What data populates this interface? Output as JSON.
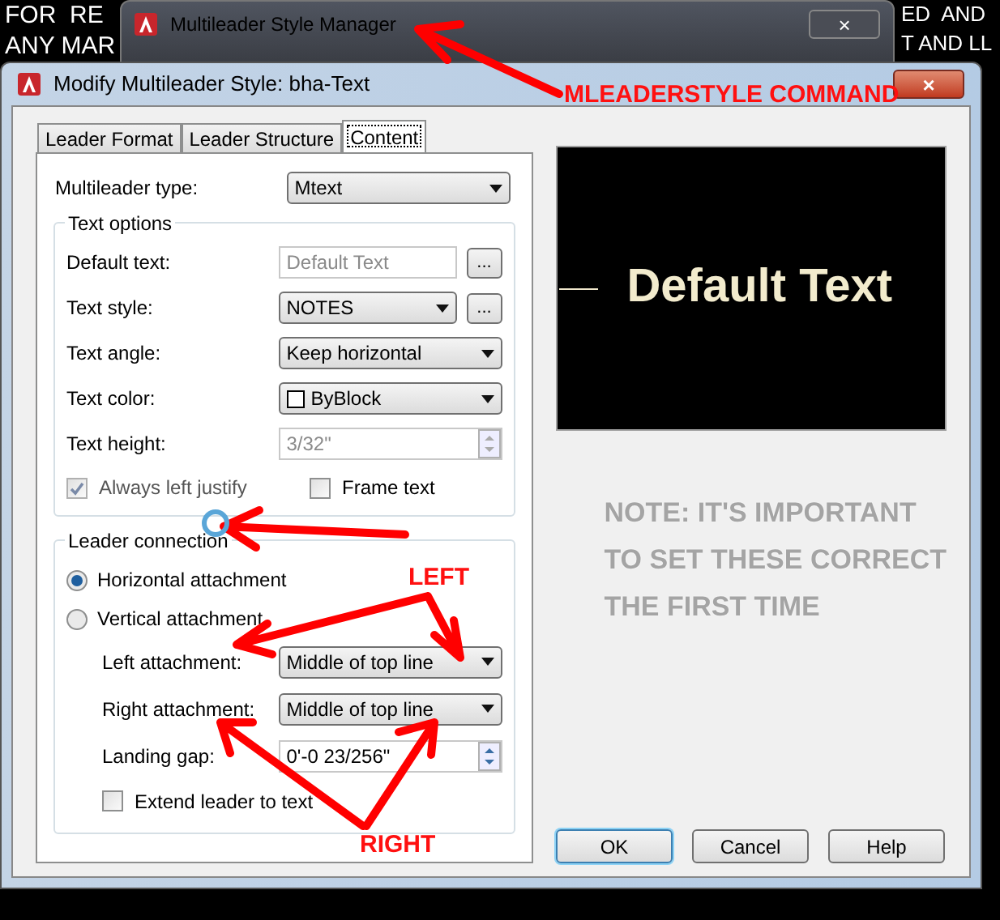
{
  "cad_background": {
    "left_lines": [
      "FOR  RE",
      "ANY MAR"
    ],
    "right_lines": [
      "ED  AND",
      "T AND LL"
    ]
  },
  "back_window": {
    "title": "Multileader Style Manager",
    "close": "×"
  },
  "dialog": {
    "title": "Modify Multileader Style: bha-Text",
    "close": "×",
    "tabs": [
      {
        "label": "Leader Format",
        "selected": false
      },
      {
        "label": "Leader Structure",
        "selected": false
      },
      {
        "label": "Content",
        "selected": true
      }
    ],
    "multileader_type": {
      "label": "Multileader type:",
      "value": "Mtext"
    },
    "text_options": {
      "title": "Text options",
      "rows": [
        {
          "kind": "text",
          "label": "Default text:",
          "value": "Default Text",
          "button": "...",
          "disabled": true
        },
        {
          "kind": "dropdown",
          "label": "Text style:",
          "value": "NOTES",
          "button": "..."
        },
        {
          "kind": "dropdown",
          "label": "Text angle:",
          "value": "Keep horizontal"
        },
        {
          "kind": "color",
          "label": "Text color:",
          "value": "ByBlock"
        },
        {
          "kind": "spinner",
          "label": "Text height:",
          "value": "3/32\"",
          "disabled": true
        }
      ],
      "checkboxes": [
        {
          "label": "Always left justify",
          "checked": true,
          "disabled": true
        },
        {
          "label": "Frame text",
          "checked": false,
          "disabled": false
        }
      ]
    },
    "leader_connection": {
      "title": "Leader connection",
      "radios": [
        {
          "label": "Horizontal attachment",
          "selected": true
        },
        {
          "label": "Vertical attachment",
          "selected": false
        }
      ],
      "rows": [
        {
          "kind": "dropdown",
          "label": "Left attachment:",
          "value": "Middle of top line"
        },
        {
          "kind": "dropdown",
          "label": "Right attachment:",
          "value": "Middle of top line"
        },
        {
          "kind": "spinner",
          "label": "Landing gap:",
          "value": "0'-0 23/256\"",
          "disabled": false
        }
      ],
      "checkbox": {
        "label": "Extend leader to text",
        "checked": false
      }
    },
    "preview_text": "Default Text",
    "note": [
      "NOTE: IT'S IMPORTANT",
      "TO SET THESE CORRECT",
      "THE FIRST TIME"
    ],
    "buttons": [
      {
        "label": "OK",
        "default": true
      },
      {
        "label": "Cancel",
        "default": false
      },
      {
        "label": "Help",
        "default": false
      }
    ]
  },
  "annotations": {
    "command": "MLEADERSTYLE COMMAND",
    "left": "LEFT",
    "right": "RIGHT"
  }
}
